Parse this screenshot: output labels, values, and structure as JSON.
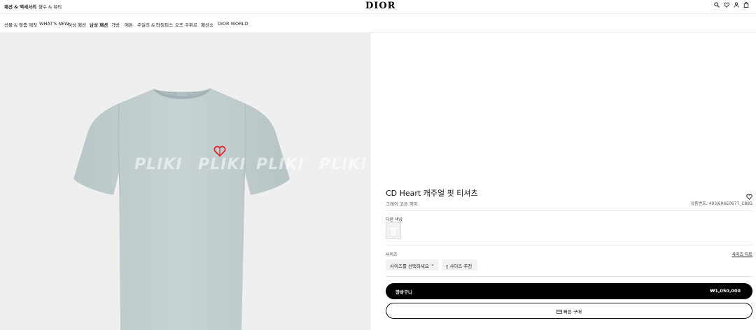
{
  "topbar": {
    "links": [
      "패션 & 액세서리",
      "향수 & 뷰티"
    ],
    "logo": "DIOR",
    "icons": [
      "search-icon",
      "heart-icon",
      "user-icon",
      "shopping-bag-icon"
    ]
  },
  "nav": {
    "items": [
      "선물 & 맞춤 제작",
      "WHAT'S NEW",
      "여성 패션",
      "남성 패션",
      "가방",
      "애톤",
      "주얼리 & 타임피스",
      "오뜨 쿠튀르",
      "패션쇼",
      "DIOR WORLD"
    ],
    "active_index": 3
  },
  "image": {
    "watermark": "PLIKI",
    "shirt_color": "#c4d0d2",
    "heart_color": "#e2262c"
  },
  "product": {
    "title": "CD Heart 캐주얼 핏 티셔츠",
    "subtitle": "그레이 코튼 저지",
    "sku": "상품번호: 493J696E0677_C883",
    "other_colors_label": "다른 색상",
    "size_label": "사이즈",
    "size_chart": "사이즈 차트",
    "size_select": "사이즈를 선택하세요",
    "size_recommend": "사이즈 추천",
    "cart_label": "장바구니",
    "price": "₩1,050,000",
    "quick_buy": "빠른 구매"
  }
}
